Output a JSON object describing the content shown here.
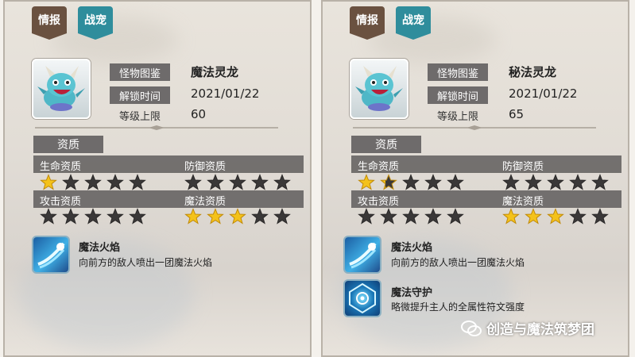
{
  "panels": [
    {
      "tabs": [
        "情报",
        "战宠"
      ],
      "labels": {
        "dex": "怪物图鉴",
        "unlock": "解锁时间",
        "level": "等级上限"
      },
      "name": "魔法灵龙",
      "unlock_date": "2021/01/22",
      "level_cap": "60",
      "section_title": "资质",
      "stats": [
        {
          "label": "生命资质",
          "stars": 1,
          "max": 5
        },
        {
          "label": "防御资质",
          "stars": 0,
          "max": 5
        },
        {
          "label": "攻击资质",
          "stars": 0,
          "max": 5
        },
        {
          "label": "魔法资质",
          "stars": 3,
          "max": 5
        }
      ],
      "skills": [
        {
          "name": "魔法火焰",
          "desc": "向前方的敌人喷出一团魔法火焰",
          "icon": "fire-breath-skill-icon"
        }
      ]
    },
    {
      "tabs": [
        "情报",
        "战宠"
      ],
      "labels": {
        "dex": "怪物图鉴",
        "unlock": "解锁时间",
        "level": "等级上限"
      },
      "name": "秘法灵龙",
      "unlock_date": "2021/01/22",
      "level_cap": "65",
      "section_title": "资质",
      "stats": [
        {
          "label": "生命资质",
          "stars": 1.3,
          "max": 5
        },
        {
          "label": "防御资质",
          "stars": 0,
          "max": 5
        },
        {
          "label": "攻击资质",
          "stars": 0,
          "max": 5
        },
        {
          "label": "魔法资质",
          "stars": 3,
          "max": 5
        }
      ],
      "skills": [
        {
          "name": "魔法火焰",
          "desc": "向前方的敌人喷出一团魔法火焰",
          "icon": "fire-breath-skill-icon"
        },
        {
          "name": "魔法守护",
          "desc": "略微提升主人的全属性符文强度",
          "icon": "magic-guard-skill-icon"
        }
      ]
    }
  ],
  "watermark": "创造与魔法筑梦团",
  "colors": {
    "star_on": "#f4c21a",
    "star_off": "#3a3838",
    "tab_info": "#6a5140",
    "tab_battle": "#2f8d9c",
    "label_bg": "#6e6b6b"
  }
}
